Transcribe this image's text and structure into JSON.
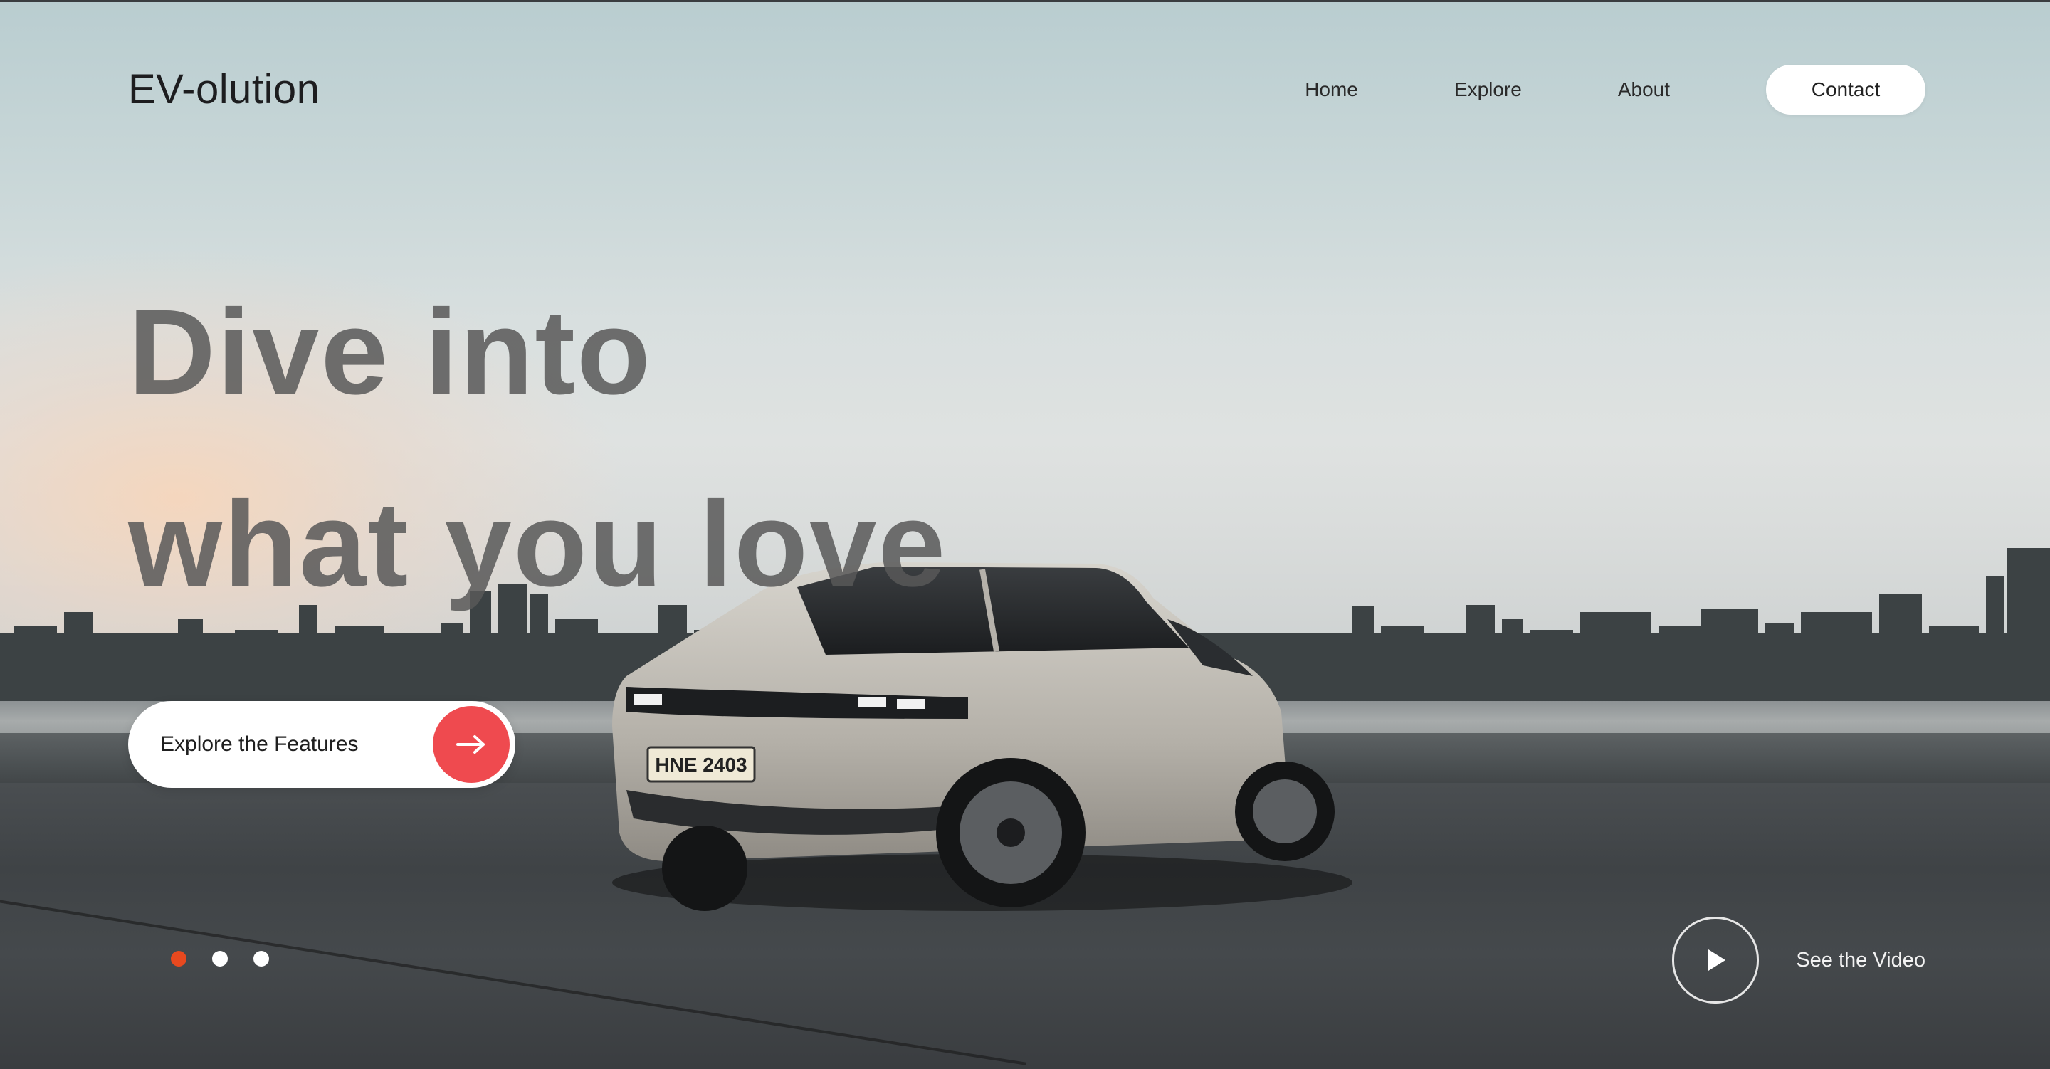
{
  "brand": {
    "logo": "EV-olution"
  },
  "nav": {
    "items": [
      {
        "label": "Home"
      },
      {
        "label": "Explore"
      },
      {
        "label": "About"
      }
    ],
    "contact_label": "Contact"
  },
  "hero": {
    "line1": "Dive into",
    "line2": "what you love",
    "cta_label": "Explore the Features",
    "cta_icon": "arrow-right-icon"
  },
  "carousel": {
    "slide_count": 3,
    "active_index": 0
  },
  "video": {
    "label": "See the Video",
    "icon": "play-icon"
  },
  "scene": {
    "plate": "HNE 2403"
  },
  "colors": {
    "accent": "#ef4a4f",
    "active_dot": "#e8491f",
    "text_dark": "#1d1d1f",
    "headline": "#585858"
  }
}
